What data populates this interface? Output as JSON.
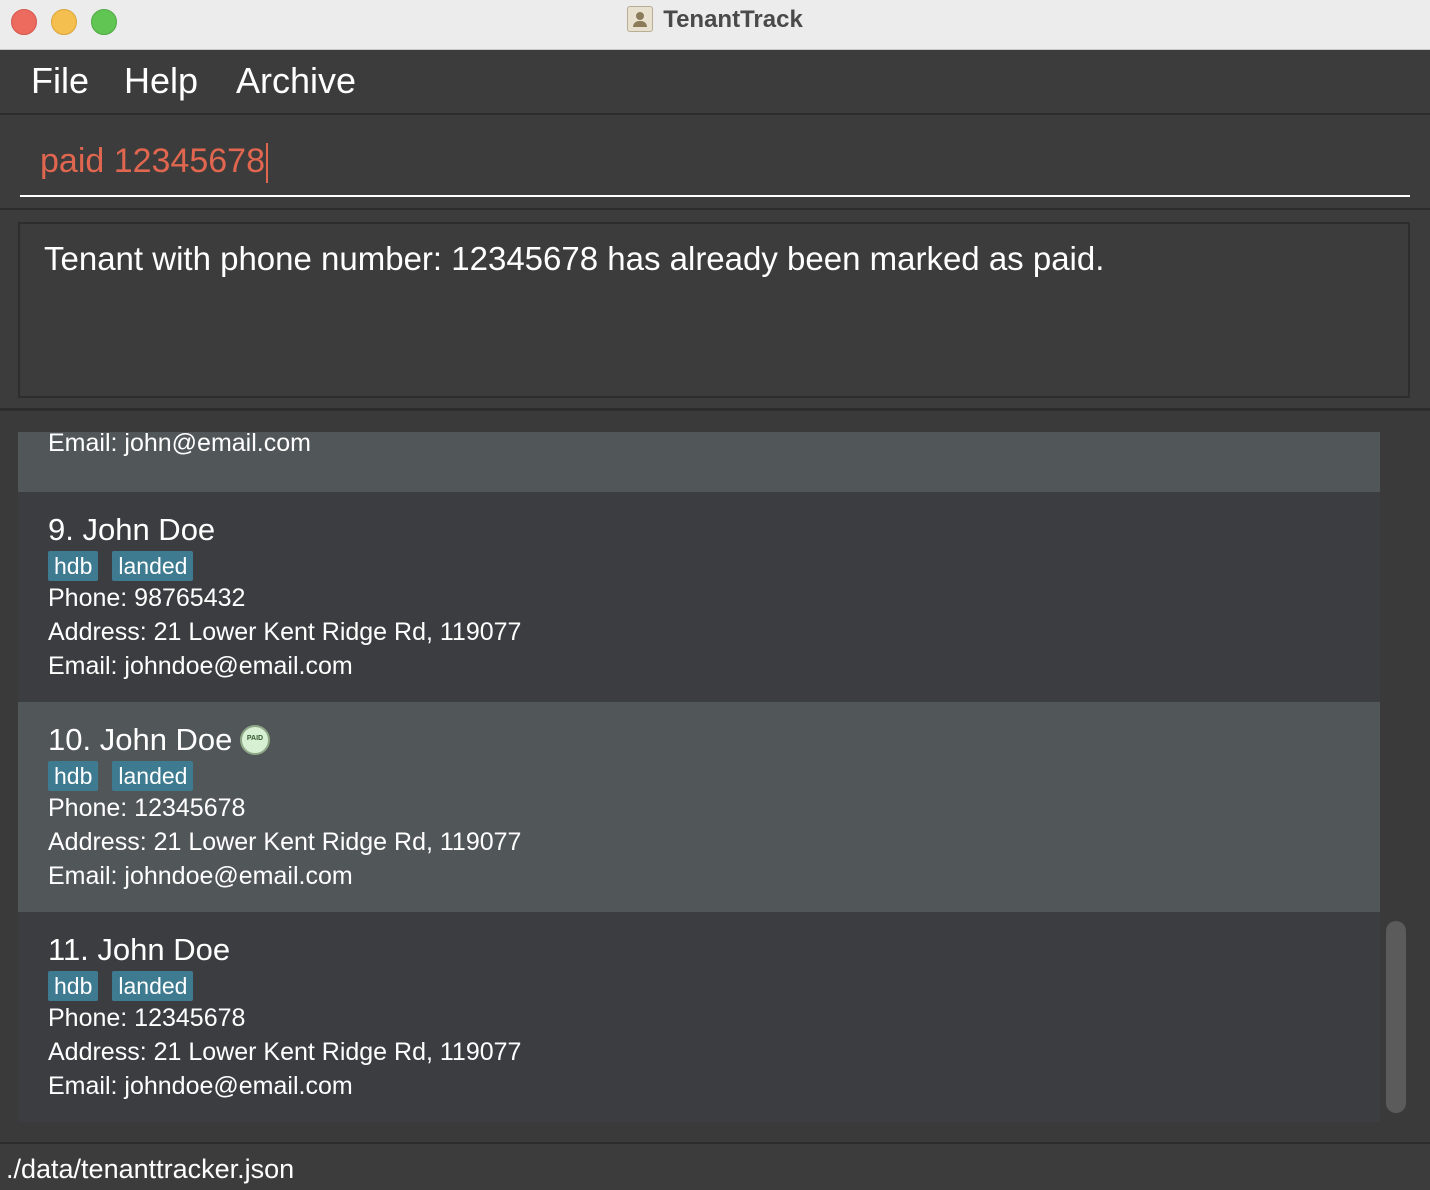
{
  "window": {
    "title": "TenantTrack"
  },
  "menu": [
    "File",
    "Help",
    "Archive"
  ],
  "command": {
    "value": "paid 12345678"
  },
  "result": {
    "text": "Tenant with phone number: 12345678 has already been marked as paid."
  },
  "partial_card": {
    "email": "Email: john@email.com"
  },
  "tenants": [
    {
      "name": "9. John Doe",
      "tags": [
        "hdb",
        "landed"
      ],
      "phone": "Phone: 98765432",
      "address": "Address: 21 Lower Kent Ridge Rd, 119077",
      "email": "Email: johndoe@email.com",
      "paid": false
    },
    {
      "name": "10. John Doe",
      "tags": [
        "hdb",
        "landed"
      ],
      "phone": "Phone: 12345678",
      "address": "Address: 21 Lower Kent Ridge Rd, 119077",
      "email": "Email: johndoe@email.com",
      "paid": true
    },
    {
      "name": "11. John Doe",
      "tags": [
        "hdb",
        "landed"
      ],
      "phone": "Phone: 12345678",
      "address": "Address: 21 Lower Kent Ridge Rd, 119077",
      "email": "Email: johndoe@email.com",
      "paid": false
    }
  ],
  "status": {
    "path": "./data/tenanttracker.json"
  },
  "icons": {
    "app": "app-icon",
    "paid": "paid-icon"
  }
}
